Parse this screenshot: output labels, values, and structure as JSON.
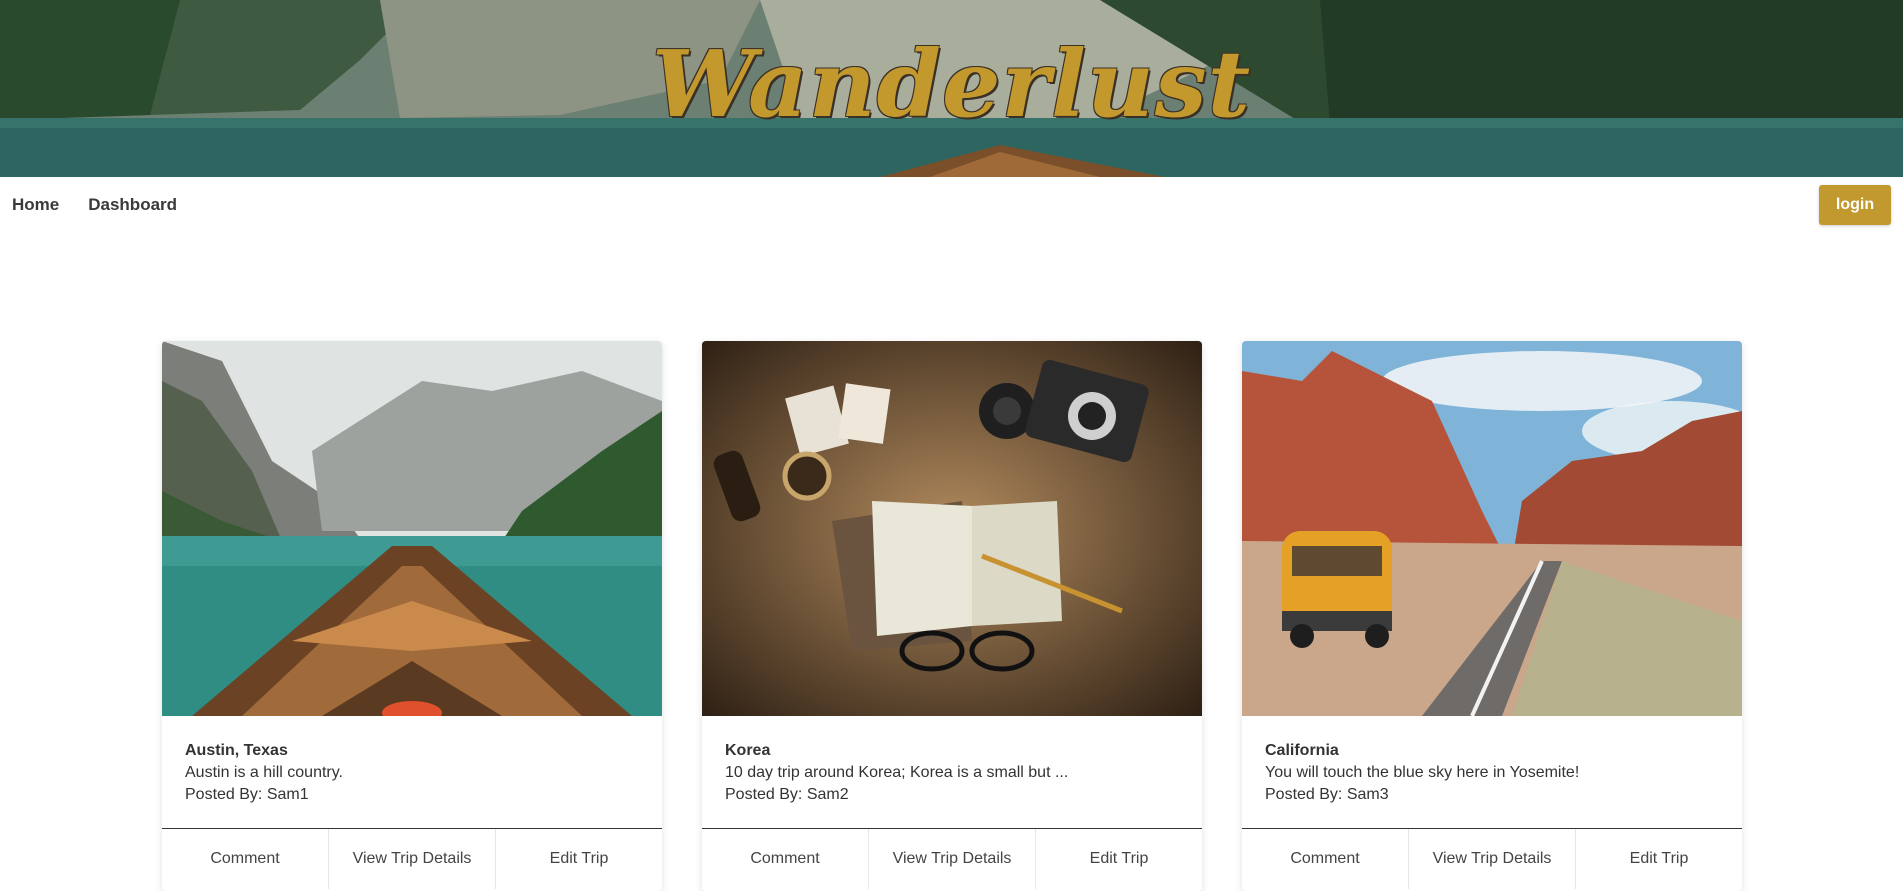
{
  "brand": {
    "title": "Wanderlust"
  },
  "nav": {
    "home_label": "Home",
    "dashboard_label": "Dashboard",
    "login_label": "login"
  },
  "colors": {
    "accent": "#c1992e",
    "brand_text": "#c3982d"
  },
  "trips": [
    {
      "title": "Austin, Texas",
      "description": "Austin is a hill country.",
      "posted_by": "Posted By: Sam1",
      "image": "boat-on-mountain-lake"
    },
    {
      "title": "Korea",
      "description": "10 day trip around Korea; Korea is a small but ...",
      "posted_by": "Posted By: Sam2",
      "image": "map-camera-notebook"
    },
    {
      "title": "California",
      "description": "You will touch the blue sky here in Yosemite!",
      "posted_by": "Posted By: Sam3",
      "image": "desert-road-van"
    }
  ],
  "card_actions": {
    "comment": "Comment",
    "view": "View Trip Details",
    "edit": "Edit Trip"
  }
}
